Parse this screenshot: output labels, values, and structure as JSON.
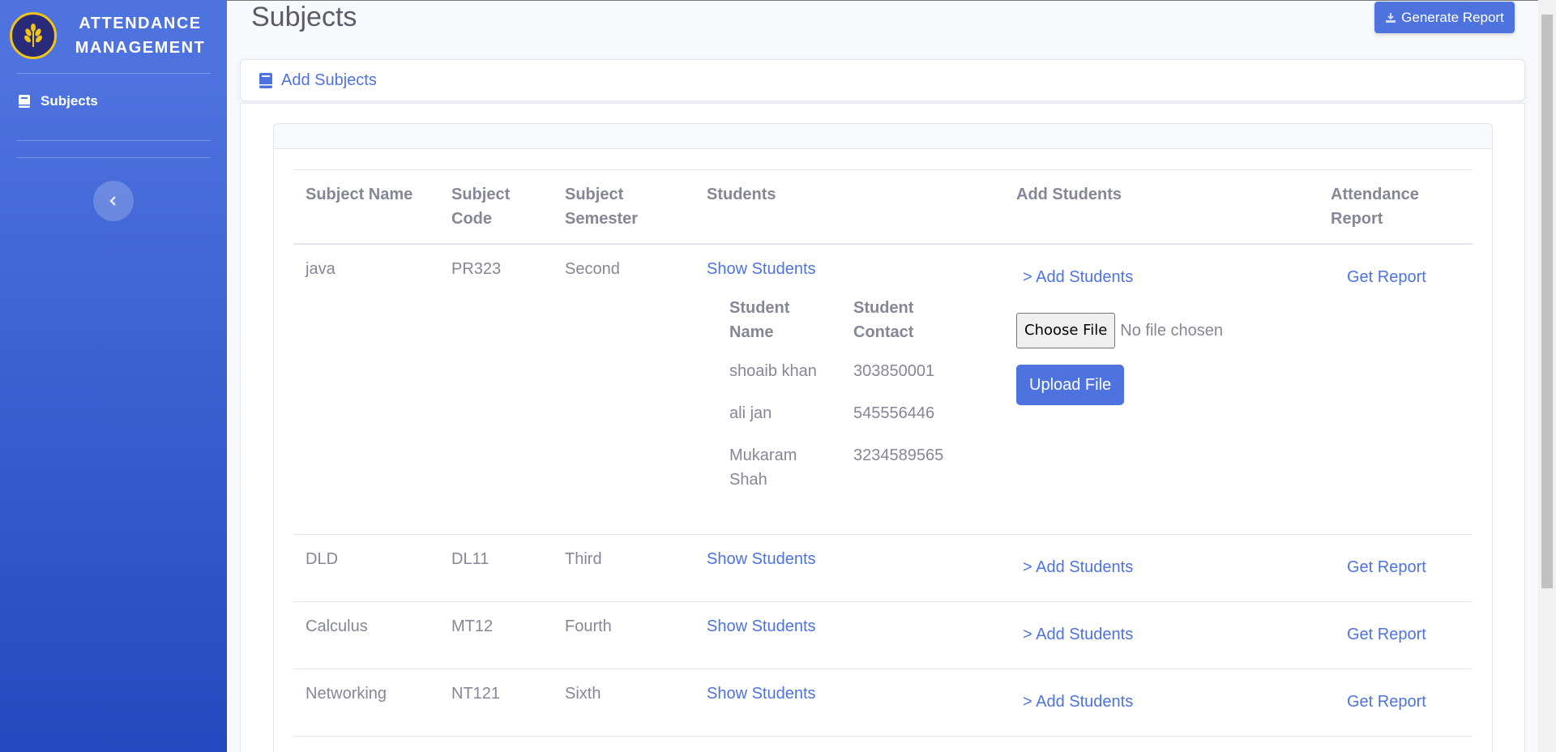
{
  "sidebar": {
    "brand_line1": "ATTENDANCE",
    "brand_line2": "MANAGEMENT",
    "items": [
      {
        "label": "Subjects",
        "icon": "book-icon"
      }
    ]
  },
  "header": {
    "title": "Subjects",
    "generate_report_label": "Generate Report"
  },
  "card": {
    "title": "Add Subjects"
  },
  "table": {
    "headers": {
      "name": "Subject Name",
      "code_line1": "Subject",
      "code_line2": "Code",
      "semester_line1": "Subject",
      "semester_line2": "Semester",
      "students": "Students",
      "add_students": "Add Students",
      "report_line1": "Attendance",
      "report_line2": "Report"
    },
    "rows": [
      {
        "name": "java",
        "code": "PR323",
        "semester": "Second",
        "show": "Show Students",
        "add": "> Add Students",
        "report": "Get Report"
      },
      {
        "name": "DLD",
        "code": "DL11",
        "semester": "Third",
        "show": "Show Students",
        "add": "> Add Students",
        "report": "Get Report"
      },
      {
        "name": "Calculus",
        "code": "MT12",
        "semester": "Fourth",
        "show": "Show Students",
        "add": "> Add Students",
        "report": "Get Report"
      },
      {
        "name": "Networking",
        "code": "NT121",
        "semester": "Sixth",
        "show": "Show Students",
        "add": "> Add Students",
        "report": "Get Report"
      }
    ]
  },
  "students": {
    "header_name_line1": "Student",
    "header_name_line2": "Name",
    "header_contact_line1": "Student",
    "header_contact_line2": "Contact",
    "rows": [
      {
        "name": "shoaib khan",
        "contact": "303850001"
      },
      {
        "name": "ali jan",
        "contact": "545556446"
      },
      {
        "name_line1": "Mukaram",
        "name_line2": "Shah",
        "contact": "3234589565"
      }
    ]
  },
  "upload": {
    "choose_label": "Choose File",
    "no_file": "No file chosen",
    "upload_label": "Upload File"
  },
  "colors": {
    "primary": "#4e73df",
    "sidebar_end": "#224abe",
    "text": "#858796"
  }
}
